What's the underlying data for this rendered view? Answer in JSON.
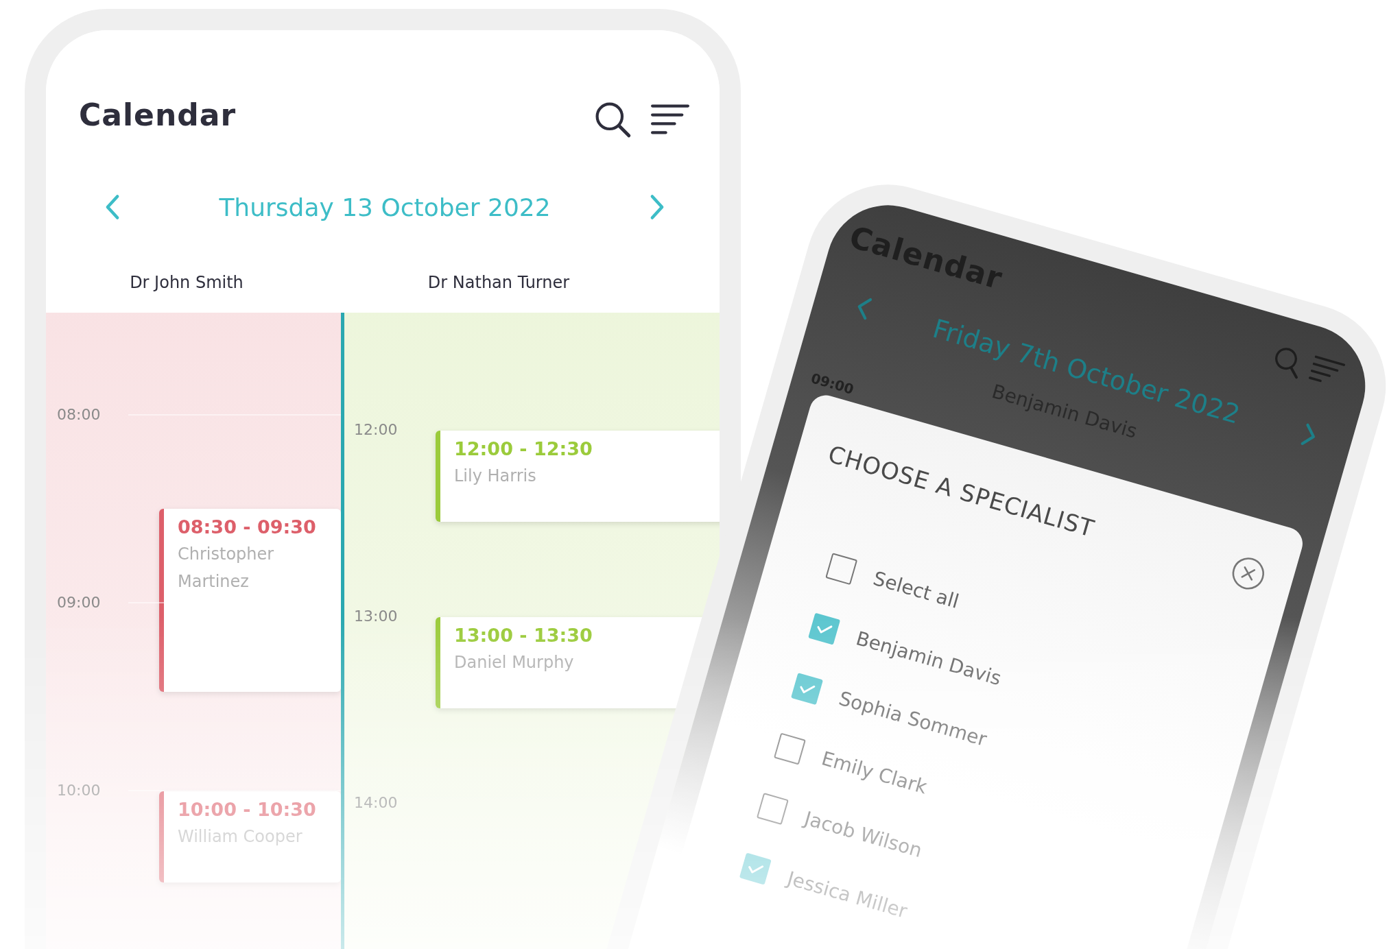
{
  "calendar": {
    "title": "Calendar",
    "date": "Thursday 13 October 2022",
    "columns": [
      {
        "doctor": "Dr John Smith",
        "color": "#dd5f6a",
        "hours": [
          {
            "time": "08:00",
            "events_half_past": [
              {
                "time": "08:30 - 09:30",
                "patient": "Christopher Martinez",
                "kind": "hour"
              }
            ]
          },
          {
            "time": "09:00"
          },
          {
            "time": "10:00",
            "events": [
              {
                "time": "10:00 - 10:30",
                "patient": "William Cooper",
                "kind": "half_hour"
              }
            ]
          }
        ]
      },
      {
        "doctor": "Dr Nathan Turner",
        "color": "#9bcb3b",
        "hours": [
          {
            "time": "12:00",
            "events": [
              {
                "time": "12:00 - 12:30",
                "patient": "Lily Harris",
                "kind": "half_hour"
              }
            ]
          },
          {
            "time": "13:00",
            "events": [
              {
                "time": "13:00 - 13:30",
                "patient": "Daniel Murphy",
                "kind": "half_hour"
              }
            ]
          },
          {
            "time": "14:00"
          }
        ]
      }
    ]
  },
  "second_screen": {
    "title": "Calendar",
    "date": "Friday 7th October 2022",
    "doctor": "Benjamin Davis",
    "time": "09:00",
    "dialog": {
      "title": "CHOOSE A SPECIALIST",
      "options": [
        {
          "label": "Select all",
          "checked": false
        },
        {
          "label": "Benjamin Davis",
          "checked": true
        },
        {
          "label": "Sophia Sommer",
          "checked": true
        },
        {
          "label": "Emily Clark",
          "checked": false
        },
        {
          "label": "Jacob Wilson",
          "checked": false
        },
        {
          "label": "Jessica Miller",
          "checked": true
        }
      ]
    }
  }
}
